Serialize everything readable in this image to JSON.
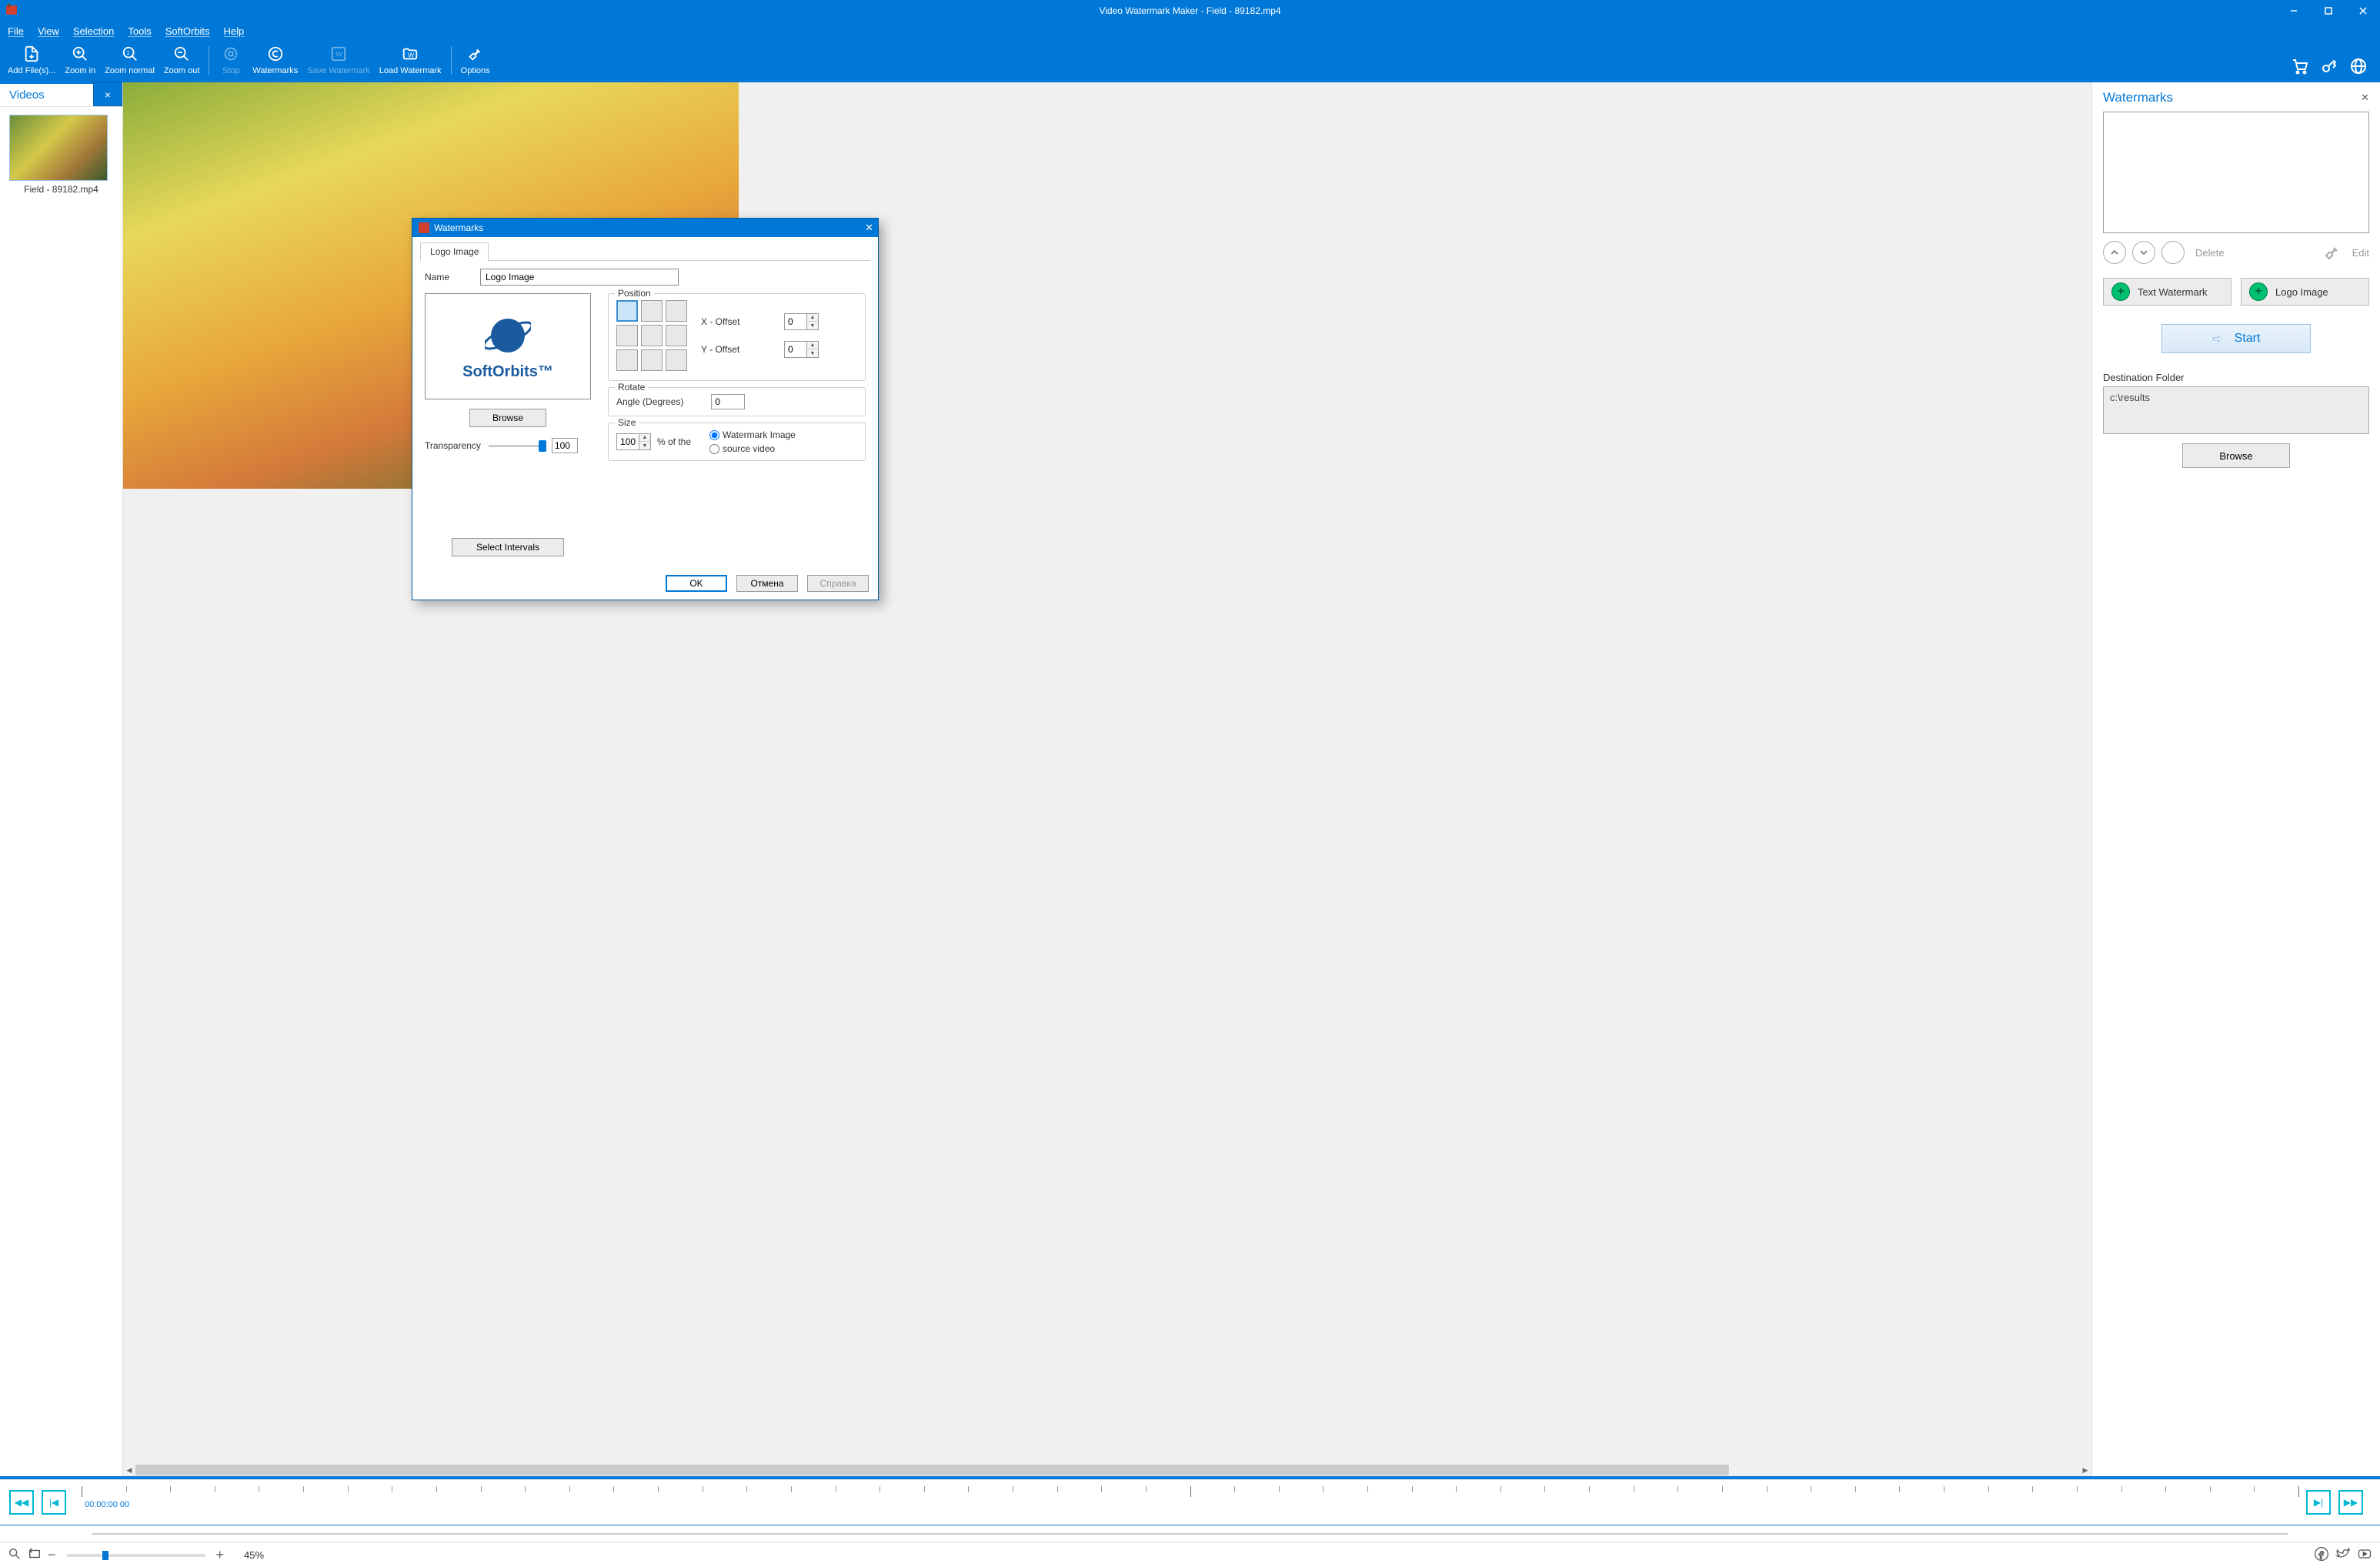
{
  "title": "Video Watermark Maker - Field - 89182.mp4",
  "menu": [
    "File",
    "View",
    "Selection",
    "Tools",
    "SoftOrbits",
    "Help"
  ],
  "toolbar": {
    "add_files": "Add File(s)...",
    "zoom_in": "Zoom in",
    "zoom_normal": "Zoom normal",
    "zoom_out": "Zoom out",
    "stop": "Stop",
    "watermarks": "Watermarks",
    "save_watermark": "Save Watermark",
    "load_watermark": "Load Watermark",
    "options": "Options"
  },
  "left": {
    "tab": "Videos",
    "thumb_label": "Field - 89182.mp4"
  },
  "right": {
    "header": "Watermarks",
    "delete": "Delete",
    "edit": "Edit",
    "text_wm": "Text Watermark",
    "logo_img": "Logo Image",
    "start": "Start",
    "dest_lbl": "Destination Folder",
    "dest_val": "c:\\results",
    "browse": "Browse"
  },
  "transport": {
    "timecode": "00:00:00 00"
  },
  "status": {
    "zoom": "45%"
  },
  "dialog": {
    "title": "Watermarks",
    "tab": "Logo Image",
    "name_lbl": "Name",
    "name_val": "Logo Image",
    "logo_text": "SoftOrbits™",
    "browse": "Browse",
    "transparency_lbl": "Transparency",
    "transparency_val": "100",
    "position_lbl": "Position",
    "x_off_lbl": "X - Offset",
    "x_off_val": "0",
    "y_off_lbl": "Y - Offset",
    "y_off_val": "0",
    "rotate_lbl": "Rotate",
    "angle_lbl": "Angle (Degrees)",
    "angle_val": "0",
    "size_lbl": "Size",
    "size_val": "100",
    "pct_of": "% of the",
    "r1": "Watermark Image",
    "r2": "source video",
    "sel_int": "Select Intervals",
    "ok": "OK",
    "cancel": "Отмена",
    "help": "Справка"
  }
}
